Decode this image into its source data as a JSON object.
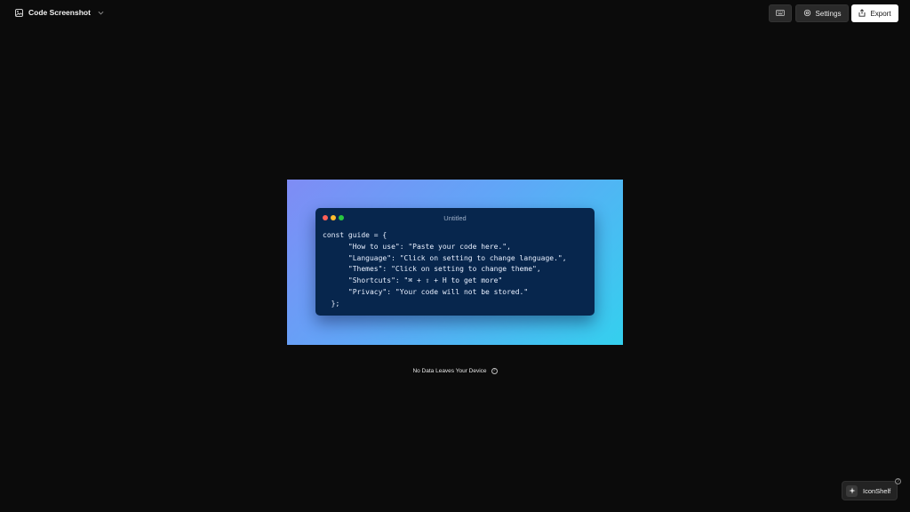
{
  "app": {
    "title": "Code Screenshot"
  },
  "toolbar": {
    "keyboard_icon": "keyboard-icon",
    "settings_label": "Settings",
    "export_label": "Export"
  },
  "editor": {
    "window_title": "Untitled",
    "code_lines": [
      "const guide = {",
      "      \"How to use\": \"Paste your code here.\",",
      "      \"Language\": \"Click on setting to change language.\",",
      "      \"Themes\": \"Click on setting to change theme\",",
      "      \"Shortcuts\": \"⌘ + ⇧ + H to get more\"",
      "      \"Privacy\": \"Your code will not be stored.\"",
      "  };"
    ],
    "gradient_colors": [
      "#7f8cf5",
      "#60a6f7",
      "#34d0ee"
    ],
    "window_bg": "#07264d"
  },
  "footer": {
    "privacy_note": "No Data Leaves Your Device",
    "help_glyph": "?"
  },
  "widget": {
    "label": "IconShelf",
    "help_glyph": "?"
  }
}
